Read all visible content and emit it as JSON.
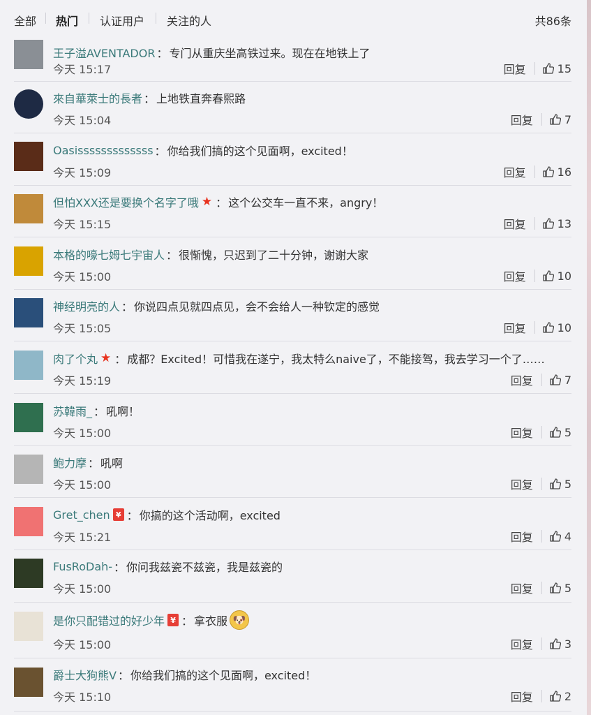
{
  "filter": {
    "tabs": [
      "全部",
      "热门",
      "认证用户",
      "关注的人"
    ],
    "active": "热门",
    "total": "共86条"
  },
  "actions": {
    "reply_label": "回复"
  },
  "comments": [
    {
      "user": "王子溢AVENTADOR",
      "text": "专门从重庆坐高铁过来。现在在地铁上了",
      "time": "今天 15:17",
      "likes": "15",
      "avatar_color": "#8a8f95"
    },
    {
      "user": "來自華萊士的長者",
      "text": "上地铁直奔春熙路",
      "time": "今天 15:04",
      "likes": "7",
      "avatar_color": "#1e2a44"
    },
    {
      "user": "Oasisssssssssssss",
      "text": "你给我们搞的这个见面啊，excited！",
      "time": "今天 15:09",
      "likes": "16",
      "avatar_color": "#5a2c18"
    },
    {
      "user": "但怕XXX还是要换个名字了哦",
      "badge": "star",
      "text": "这个公交车一直不来，angry！",
      "time": "今天 15:15",
      "likes": "13",
      "avatar_color": "#c08a3a"
    },
    {
      "user": "本格的嚎七姆七宇宙人",
      "text": "很惭愧，只迟到了二十分钟，谢谢大家",
      "time": "今天 15:00",
      "likes": "10",
      "avatar_color": "#d9a300"
    },
    {
      "user": "神经明亮的人",
      "text": "你说四点见就四点见，会不会给人一种钦定的感觉",
      "time": "今天 15:05",
      "likes": "10",
      "avatar_color": "#2a4f7a"
    },
    {
      "user": "肉了个丸",
      "badge": "star",
      "text": "成都？Excited！可惜我在遂宁，我太特么naive了，不能接驾，我去学习一个了……",
      "time": "今天 15:19",
      "likes": "7",
      "avatar_color": "#8fb7c8"
    },
    {
      "user": "苏韓雨_",
      "text": "吼啊！",
      "time": "今天 15:00",
      "likes": "5",
      "avatar_color": "#2f6f4f"
    },
    {
      "user": "鲍力摩",
      "text": "吼啊",
      "time": "今天 15:00",
      "likes": "5",
      "avatar_color": "#b5b5b5"
    },
    {
      "user": "Gret_chen",
      "badge": "red",
      "text": "你搞的这个活动啊，excited",
      "time": "今天 15:21",
      "likes": "4",
      "avatar_color": "#f07272"
    },
    {
      "user": "FusRoDah-",
      "text": "你问我兹瓷不兹瓷，我是兹瓷的",
      "time": "今天 15:00",
      "likes": "5",
      "avatar_color": "#2d3a24"
    },
    {
      "user": "是你只配错过的好少年",
      "badge": "red",
      "text": "拿衣服",
      "emoji": "doge",
      "time": "今天 15:00",
      "likes": "3",
      "avatar_color": "#e8e2d6"
    },
    {
      "user": "爵士大狗熊V",
      "text": "你给我们搞的这个见面啊，excited！",
      "time": "今天 15:10",
      "likes": "2",
      "avatar_color": "#6a5230"
    }
  ]
}
